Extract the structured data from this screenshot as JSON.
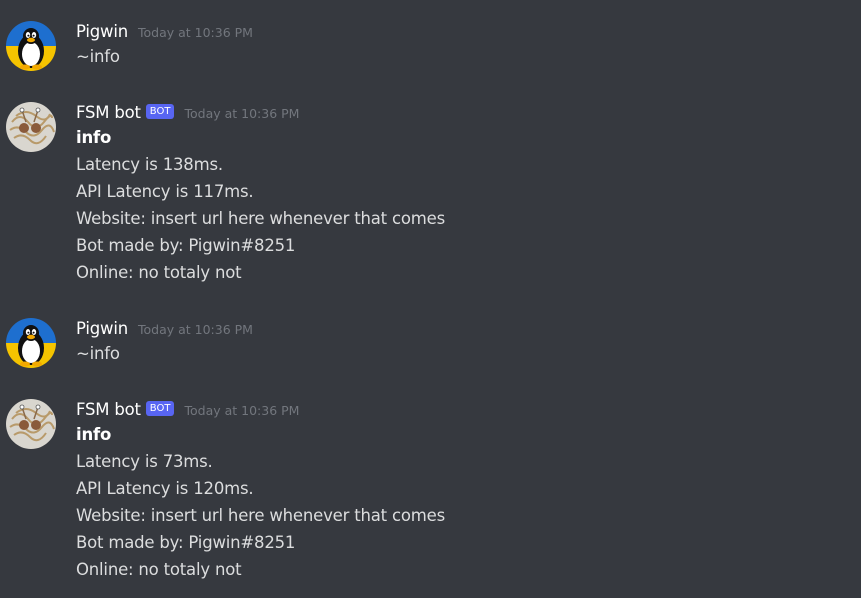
{
  "messages": [
    {
      "username": "Pigwin",
      "timestamp": "Today at 10:36 PM",
      "avatar_icon": "penguin-avatar",
      "content": "~info"
    },
    {
      "username": "FSM bot",
      "badge": "BOT",
      "timestamp": "Today at 10:36 PM",
      "avatar_icon": "spaghetti-monster-avatar",
      "embed_title": "info",
      "lines": [
        "Latency is 138ms.",
        "API Latency is 117ms.",
        "Website: insert url here whenever that comes",
        "Bot made by: Pigwin#8251",
        "Online: no totaly not"
      ]
    },
    {
      "username": "Pigwin",
      "timestamp": "Today at 10:36 PM",
      "avatar_icon": "penguin-avatar",
      "content": "~info"
    },
    {
      "username": "FSM bot",
      "badge": "BOT",
      "timestamp": "Today at 10:36 PM",
      "avatar_icon": "spaghetti-monster-avatar",
      "embed_title": "info",
      "lines": [
        "Latency is 73ms.",
        "API Latency is 120ms.",
        "Website: insert url here whenever that comes",
        "Bot made by: Pigwin#8251",
        "Online: no totaly not"
      ]
    }
  ],
  "colors": {
    "background": "#36393f",
    "username": "#ffffff",
    "message_text": "#dcddde",
    "timestamp": "#72767d",
    "bot_badge": "#5865f2",
    "penguin_bg_top": "#1e6fcf",
    "penguin_bg_bottom": "#f5c400"
  }
}
